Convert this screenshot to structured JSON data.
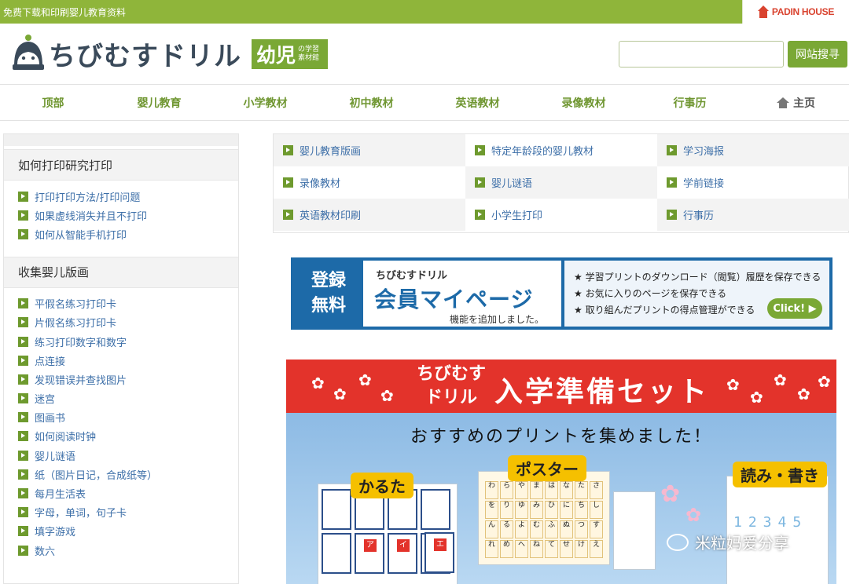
{
  "topbar": {
    "tagline": "免费下载和印刷婴儿教育资料",
    "partner": "PADIN HOUSE"
  },
  "header": {
    "logo_text": "ちびむすドリル",
    "badge_big": "幼児",
    "badge_small": "の学習素材館",
    "search_placeholder": "",
    "search_button": "网站搜寻"
  },
  "nav": [
    "顶部",
    "婴儿教育",
    "小学教材",
    "初中教材",
    "英语教材",
    "录像教材",
    "行事历",
    "主页"
  ],
  "sidebar": {
    "section1": {
      "title": "如何打印研究打印",
      "items": [
        "打印打印方法/打印问题",
        "如果虚线消失并且不打印",
        "如何从智能手机打印"
      ]
    },
    "section2": {
      "title": "收集婴儿版画",
      "items": [
        "平假名练习打印卡",
        "片假名练习打印卡",
        "练习打印数字和数字",
        "点连接",
        "发现错误并查找图片",
        "迷宫",
        "图画书",
        "如何阅读时钟",
        "婴儿谜语",
        "纸（图片日记，合成纸等）",
        "每月生活表",
        "字母，单词，句子卡",
        "填字游戏",
        "数六"
      ]
    }
  },
  "categories": [
    [
      "婴儿教育版画",
      "特定年龄段的婴儿教材",
      "学习海报"
    ],
    [
      "录像教材",
      "婴儿谜语",
      "学前链接"
    ],
    [
      "英语教材印刷",
      "小学生打印",
      "行事历"
    ]
  ],
  "member_banner": {
    "left": [
      "登録",
      "無料"
    ],
    "logo": "ちびむすドリル",
    "title": "会員マイページ",
    "subtitle": "機能を追加しました。",
    "features": [
      "★ 学習プリントのダウンロード（閲覧）履歴を保存できる",
      "★ お気に入りのページを保存できる",
      "★ 取り組んだプリントの得点管理ができる"
    ],
    "click": "Click! ▶"
  },
  "big_banner": {
    "title_line1": "ちびむす",
    "title_line2": "ドリル",
    "title_main": "入学準備セット",
    "subtitle": "おすすめのプリントを集めました！",
    "label_karuta": "かるた",
    "label_poster": "ポスター",
    "label_read": "読み・書き",
    "karuta_letters": [
      "ア",
      "イ",
      "ウ",
      "エ"
    ],
    "poster_chars": [
      "わ",
      "ら",
      "や",
      "ま",
      "は",
      "な",
      "た",
      "さ",
      "か",
      "あ",
      "を",
      "り",
      "ゆ",
      "み",
      "ひ",
      "に",
      "ち",
      "し",
      "き",
      "い",
      "ん",
      "る",
      "よ",
      "む",
      "ふ",
      "ぬ",
      "つ",
      "す",
      "く",
      "う",
      "れ",
      "め",
      "へ",
      "ね",
      "て",
      "せ",
      "け",
      "え",
      "ろ",
      "も"
    ],
    "numbers": "12345"
  },
  "watermark": "米粒妈爱分享"
}
